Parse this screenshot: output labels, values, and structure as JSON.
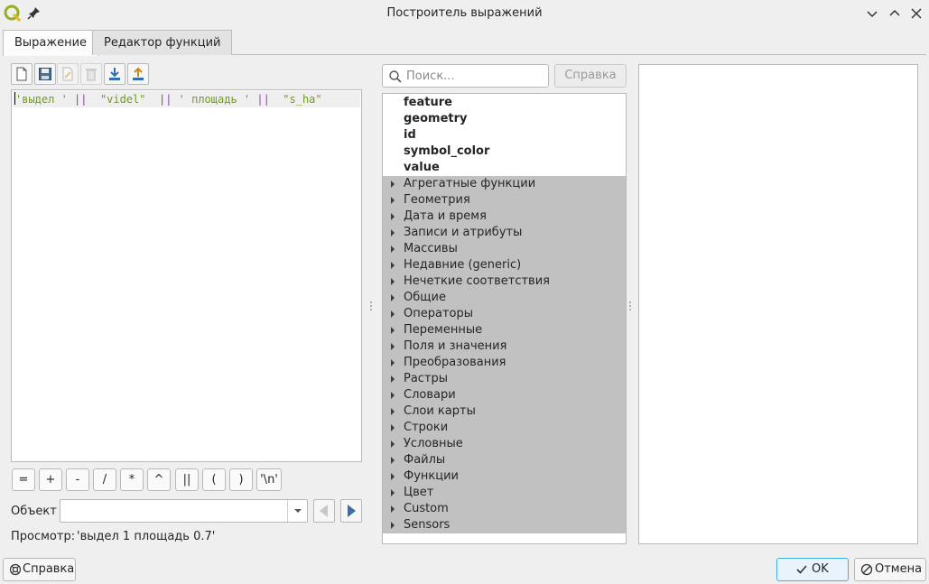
{
  "window": {
    "title": "Построитель выражений",
    "icons": [
      "qgis-logo-icon",
      "pin-icon",
      "minimize-icon",
      "maximize-icon",
      "close-icon"
    ]
  },
  "tabs": [
    {
      "label": "Выражение",
      "active": true
    },
    {
      "label": "Редактор функций",
      "active": false
    }
  ],
  "toolbar": {
    "buttons": [
      {
        "name": "new-file-icon",
        "enabled": true
      },
      {
        "name": "save-icon",
        "enabled": true
      },
      {
        "name": "edit-icon",
        "enabled": false
      },
      {
        "name": "delete-icon",
        "enabled": false
      },
      {
        "name": "import-icon",
        "enabled": true
      },
      {
        "name": "export-icon",
        "enabled": true
      }
    ]
  },
  "editor": {
    "tokens": [
      "'выдел '",
      "||",
      "\"videl\"",
      "||",
      "' площадь '",
      "||",
      "\"s_ha\""
    ]
  },
  "operators": [
    "=",
    "+",
    "-",
    "/",
    "*",
    "^",
    "||",
    "(",
    ")",
    "'\\n'"
  ],
  "object": {
    "label": "Объект",
    "value": ""
  },
  "preview": {
    "label": "Просмотр:",
    "value": "'выдел 1 площадь 0.7'"
  },
  "search": {
    "placeholder": "Поиск..."
  },
  "help_top_label": "Справка",
  "tree": {
    "fields": [
      "feature",
      "geometry",
      "id",
      "symbol_color",
      "value"
    ],
    "groups": [
      "Агрегатные функции",
      "Геометрия",
      "Дата и время",
      "Записи и атрибуты",
      "Массивы",
      "Недавние (generic)",
      "Нечеткие соответствия",
      "Общие",
      "Операторы",
      "Переменные",
      "Поля и значения",
      "Преобразования",
      "Растры",
      "Словари",
      "Слои карты",
      "Строки",
      "Условные",
      "Файлы",
      "Функции",
      "Цвет",
      "Custom",
      "Sensors"
    ]
  },
  "buttons": {
    "help": "Справка",
    "ok": "OK",
    "cancel": "Отмена"
  },
  "colors": {
    "string_token": "#6f9c18",
    "operator_token": "#8c42b5",
    "selection": "#c1c1c1",
    "accent": "#3daee9"
  }
}
